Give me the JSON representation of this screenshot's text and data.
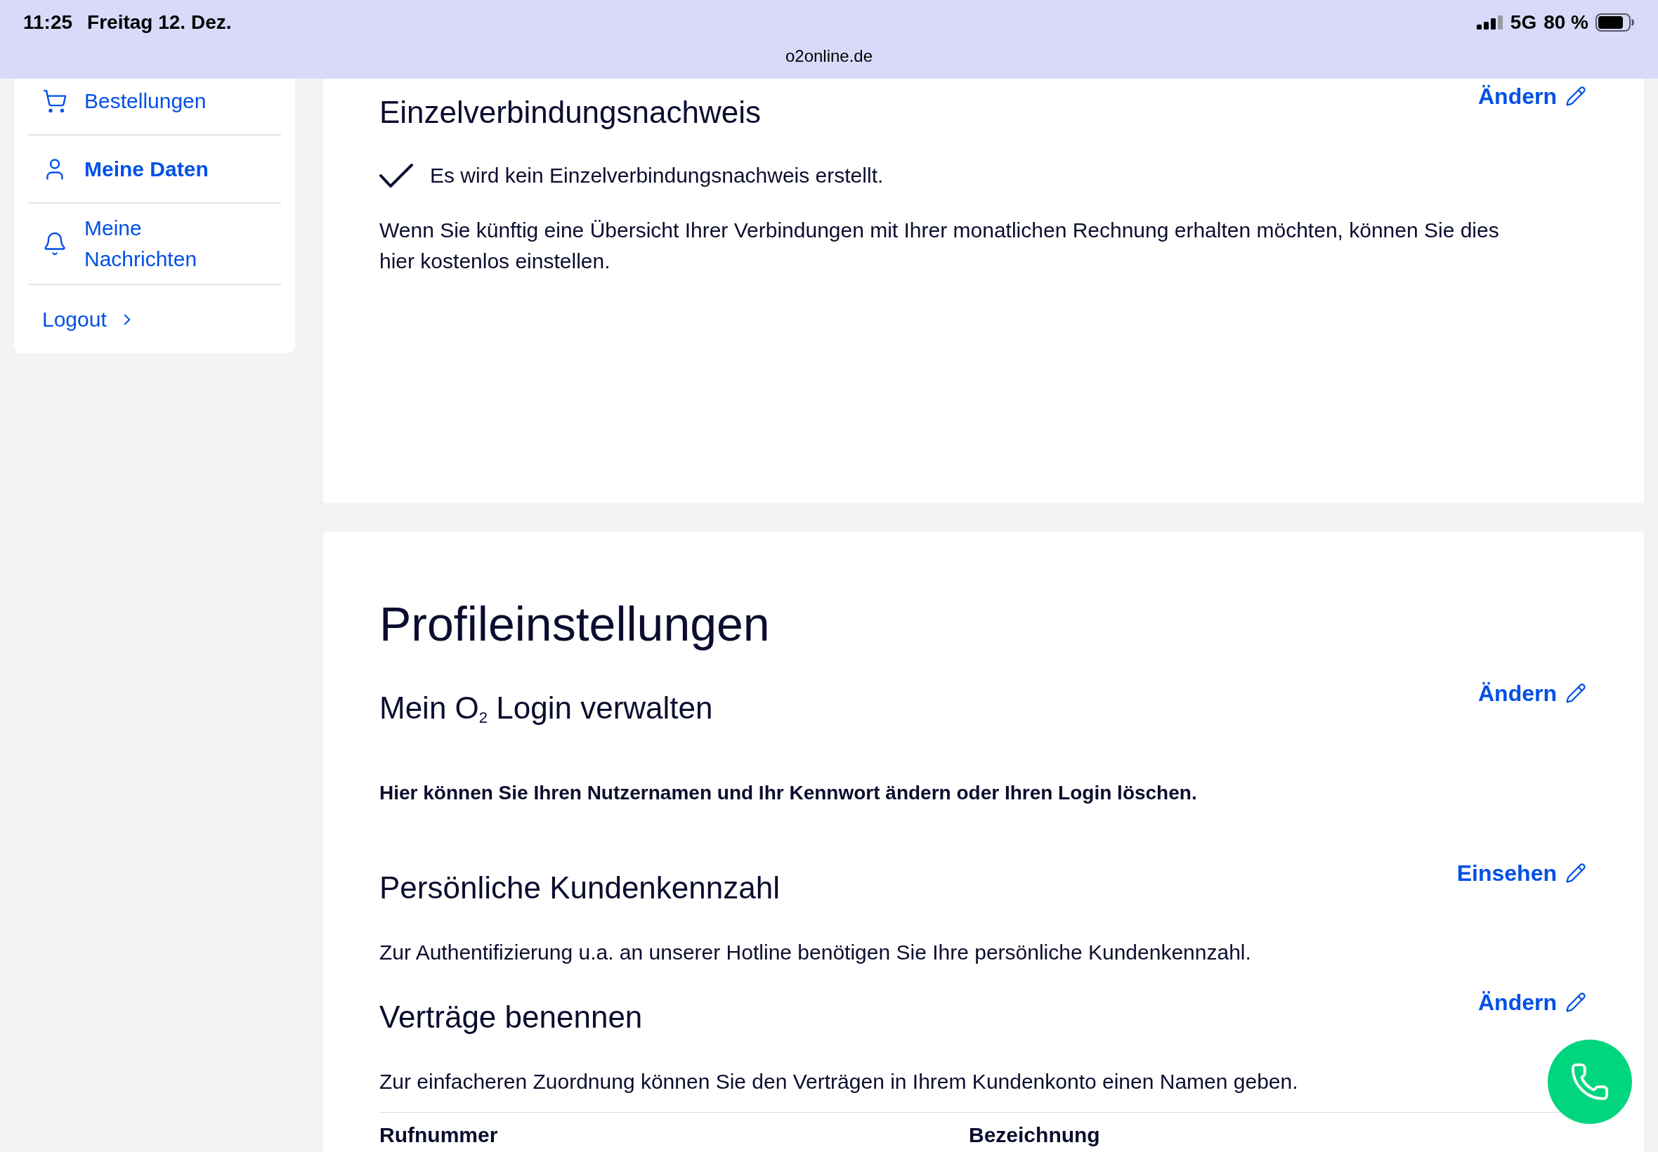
{
  "status_bar": {
    "time": "11:25",
    "date": "Freitag 12. Dez.",
    "url": "o2online.de",
    "network": "5G",
    "battery": "80 %"
  },
  "sidebar": {
    "items": [
      {
        "label": "Bestellungen",
        "selected": false
      },
      {
        "label": "Meine Daten",
        "selected": true
      },
      {
        "label": "Meine Nachrichten",
        "selected": false
      }
    ],
    "logout": "Logout"
  },
  "connection_record": {
    "title": "Einzelverbindungsnachweis",
    "action": "Ändern",
    "status": "Es wird kein Einzelverbindungsnachweis erstellt.",
    "description": "Wenn Sie künftig eine Übersicht Ihrer Verbindungen mit Ihrer monatlichen Rechnung erhalten möchten, können Sie dies hier kostenlos einstellen."
  },
  "profile_settings": {
    "title": "Profileinstellungen",
    "sections": [
      {
        "title": "Mein O$_{2}$ Login verwalten",
        "action": "Ändern",
        "description": "Hier können Sie Ihren Nutzernamen und Ihr Kennwort ändern oder Ihren Login löschen.",
        "emphasized": true
      },
      {
        "title": "Persönliche Kundenkennzahl",
        "action": "Einsehen",
        "description": "Zur Authentifizierung u.a. an unserer Hotline benötigen Sie Ihre persönliche Kundenkennzahl.",
        "emphasized": false
      },
      {
        "title": "Verträge benennen",
        "action": "Ändern",
        "description": "Zur einfacheren Zuordnung können Sie den Verträgen in Ihrem Kundenkonto einen Namen geben.",
        "emphasized": false
      }
    ],
    "table": {
      "columns": [
        "Rufnummer",
        "Bezeichnung"
      ]
    }
  }
}
